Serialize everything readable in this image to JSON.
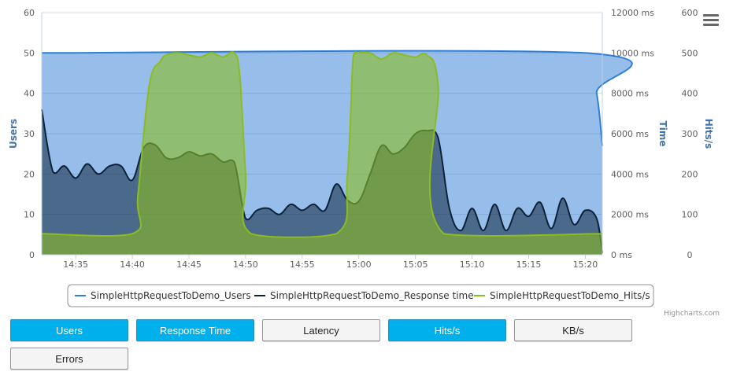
{
  "chart_data": {
    "type": "area",
    "x_tick_labels": [
      "14:35",
      "14:40",
      "14:45",
      "14:50",
      "14:55",
      "15:00",
      "15:05",
      "15:10",
      "15:15",
      "15:20"
    ],
    "y_axes": [
      {
        "title": "Users",
        "range": [
          0,
          60
        ],
        "ticks": [
          "0",
          "10",
          "20",
          "30",
          "40",
          "50",
          "60"
        ]
      },
      {
        "title": "Time",
        "range": [
          0,
          12000
        ],
        "ticks": [
          "0 ms",
          "2000 ms",
          "4000 ms",
          "6000 ms",
          "8000 ms",
          "10000 ms",
          "12000 ms"
        ]
      },
      {
        "title": "Hits/s",
        "range": [
          0,
          600
        ],
        "ticks": [
          "0",
          "100",
          "200",
          "300",
          "400",
          "500",
          "600"
        ]
      }
    ],
    "series": [
      {
        "name": "SimpleHttpRequestToDemo_Users",
        "color": "#2f7ed8",
        "axis": "Users",
        "points": [
          [
            "14:32",
            50
          ],
          [
            "15:20",
            50
          ],
          [
            "15:21",
            40
          ],
          [
            "15:21.5",
            27
          ]
        ]
      },
      {
        "name": "SimpleHttpRequestToDemo_Response time",
        "color": "#0d233a",
        "axis": "Time",
        "points": [
          [
            "14:32",
            7200
          ],
          [
            "14:33",
            4100
          ],
          [
            "14:34",
            4400
          ],
          [
            "14:35",
            3800
          ],
          [
            "14:36",
            4500
          ],
          [
            "14:37",
            4000
          ],
          [
            "14:38",
            4400
          ],
          [
            "14:39",
            4400
          ],
          [
            "14:40",
            3700
          ],
          [
            "14:41",
            5300
          ],
          [
            "14:42",
            5450
          ],
          [
            "14:43",
            4800
          ],
          [
            "14:44",
            4800
          ],
          [
            "14:45",
            5100
          ],
          [
            "14:46",
            4900
          ],
          [
            "14:47",
            5000
          ],
          [
            "14:48",
            4600
          ],
          [
            "14:49",
            4600
          ],
          [
            "14:50",
            1800
          ],
          [
            "14:51",
            2200
          ],
          [
            "14:52",
            2300
          ],
          [
            "14:53",
            2000
          ],
          [
            "14:54",
            2500
          ],
          [
            "14:55",
            2200
          ],
          [
            "14:56",
            2500
          ],
          [
            "14:57",
            2200
          ],
          [
            "14:58",
            3500
          ],
          [
            "14:59",
            2700
          ],
          [
            "15:00",
            2650
          ],
          [
            "15:01",
            4000
          ],
          [
            "15:02",
            5400
          ],
          [
            "15:03",
            5000
          ],
          [
            "15:04",
            5300
          ],
          [
            "15:05",
            6000
          ],
          [
            "15:06",
            6150
          ],
          [
            "15:07",
            5800
          ],
          [
            "15:08",
            2300
          ],
          [
            "15:09",
            1200
          ],
          [
            "15:10",
            2300
          ],
          [
            "15:11",
            1200
          ],
          [
            "15:12",
            2500
          ],
          [
            "15:13",
            1200
          ],
          [
            "15:14",
            2300
          ],
          [
            "15:15",
            1900
          ],
          [
            "15:16",
            2600
          ],
          [
            "15:17",
            1300
          ],
          [
            "15:18",
            2800
          ],
          [
            "15:19",
            1500
          ],
          [
            "15:20",
            2200
          ],
          [
            "15:21",
            1800
          ],
          [
            "15:21.5",
            100
          ]
        ]
      },
      {
        "name": "SimpleHttpRequestToDemo_Hits/s",
        "color": "#8bbc21",
        "axis": "Hits/s",
        "points": [
          [
            "14:32",
            52
          ],
          [
            "14:40",
            52
          ],
          [
            "14:40.5",
            150
          ],
          [
            "14:41.5",
            420
          ],
          [
            "14:42.5",
            480
          ],
          [
            "14:43",
            495
          ],
          [
            "14:44",
            500
          ],
          [
            "14:45",
            495
          ],
          [
            "14:46",
            490
          ],
          [
            "14:47",
            500
          ],
          [
            "14:48",
            490
          ],
          [
            "14:49",
            500
          ],
          [
            "14:49.5",
            440
          ],
          [
            "14:50",
            200
          ],
          [
            "14:50.5",
            52
          ],
          [
            "14:58",
            52
          ],
          [
            "14:59",
            200
          ],
          [
            "14:59.5",
            490
          ],
          [
            "15:00",
            500
          ],
          [
            "15:01",
            500
          ],
          [
            "15:02",
            485
          ],
          [
            "15:03",
            500
          ],
          [
            "15:04",
            495
          ],
          [
            "15:05",
            490
          ],
          [
            "15:06",
            495
          ],
          [
            "15:07",
            420
          ],
          [
            "15:07.5",
            52
          ],
          [
            "15:21.5",
            52
          ]
        ]
      }
    ],
    "legend_position": "bottom-center",
    "grid": true
  },
  "legend": [
    {
      "label": "SimpleHttpRequestToDemo_Users",
      "color": "#2f7ed8"
    },
    {
      "label": "SimpleHttpRequestToDemo_Response time",
      "color": "#0d233a"
    },
    {
      "label": "SimpleHttpRequestToDemo_Hits/s",
      "color": "#8bbc21"
    }
  ],
  "credits": "Highcharts.com",
  "buttons": [
    {
      "label": "Users",
      "active": true
    },
    {
      "label": "Response Time",
      "active": true
    },
    {
      "label": "Latency",
      "active": false
    },
    {
      "label": "Hits/s",
      "active": true
    },
    {
      "label": "KB/s",
      "active": false
    },
    {
      "label": "Errors",
      "active": false
    }
  ]
}
